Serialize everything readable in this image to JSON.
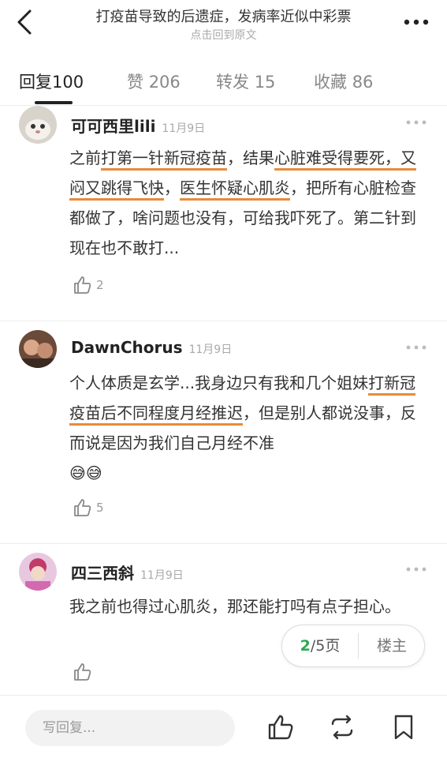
{
  "header": {
    "title": "打疫苗导致的后遗症，发病率近似中彩票",
    "subtitle": "点击回到原文"
  },
  "tabs": [
    {
      "label": "回复",
      "count": "100"
    },
    {
      "label": "赞",
      "count": "206"
    },
    {
      "label": "转发",
      "count": "15"
    },
    {
      "label": "收藏",
      "count": "86"
    }
  ],
  "comments": [
    {
      "name": "可可西里lili",
      "date": "11月9日",
      "text": {
        "p1": "之前",
        "h1": "打第一针新冠疫苗",
        "p2": "，结果",
        "h2": "心脏难受得要",
        "h3": "死，又闷又跳得飞快",
        "p3": "，",
        "h4": "医生怀疑心肌炎",
        "p4": "，把所有心脏检查都做了，啥问题也没有，可给我吓死了。第二针到现在也不敢打..."
      },
      "likes": "2"
    },
    {
      "name": "DawnChorus",
      "date": "11月9日",
      "text": {
        "p1": "个人体质是玄学...我身边只有我和几个姐妹",
        "h1": "打新冠疫苗后不同程度月经推迟",
        "p2": "，但是别人都说没事，反而说是因为我们自己月经不准",
        "emoji": "😅😅"
      },
      "likes": "5"
    },
    {
      "name": "四三西斜",
      "date": "11月9日",
      "text": {
        "p1": "我之前也得过心肌炎，那还能打吗有点子担心。"
      },
      "likes": ""
    }
  ],
  "pager": {
    "current": "2",
    "rest": "/5页",
    "op_label": "楼主"
  },
  "bottombar": {
    "reply_placeholder": "写回复..."
  },
  "colors": {
    "highlight": "#e88a3c",
    "pager_current": "#2fa84f"
  }
}
